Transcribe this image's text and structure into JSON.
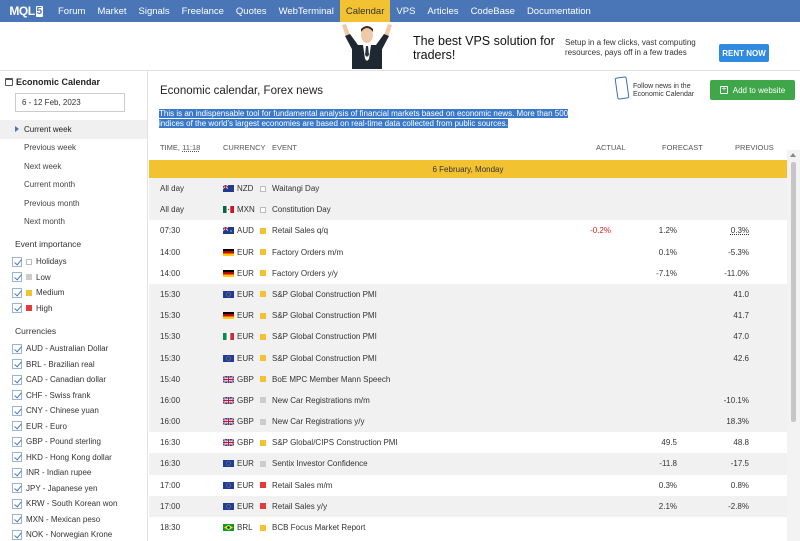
{
  "nav": {
    "logo": "MQL",
    "logo_suffix": "5",
    "items": [
      {
        "label": "Forum",
        "active": false
      },
      {
        "label": "Market",
        "active": false
      },
      {
        "label": "Signals",
        "active": false
      },
      {
        "label": "Freelance",
        "active": false
      },
      {
        "label": "Quotes",
        "active": false
      },
      {
        "label": "WebTerminal",
        "active": false
      },
      {
        "label": "Calendar",
        "active": true
      },
      {
        "label": "VPS",
        "active": false
      },
      {
        "label": "Articles",
        "active": false
      },
      {
        "label": "CodeBase",
        "active": false
      },
      {
        "label": "Documentation",
        "active": false
      }
    ]
  },
  "banner": {
    "headline": "The best VPS solution for traders!",
    "sub": "Setup in a few clicks, vast computing resources, pays off in a few trades",
    "button": "RENT NOW"
  },
  "sidebar": {
    "title": "Economic Calendar",
    "date_range": "6 - 12 Feb, 2023",
    "periods": [
      {
        "label": "Current week",
        "active": true
      },
      {
        "label": "Previous week",
        "active": false
      },
      {
        "label": "Next week",
        "active": false
      },
      {
        "label": "Current month",
        "active": false
      },
      {
        "label": "Previous month",
        "active": false
      },
      {
        "label": "Next month",
        "active": false
      }
    ],
    "importance_title": "Event importance",
    "importance": [
      {
        "label": "Holidays",
        "level": "holidays"
      },
      {
        "label": "Low",
        "level": "low"
      },
      {
        "label": "Medium",
        "level": "medium"
      },
      {
        "label": "High",
        "level": "high"
      }
    ],
    "currencies_title": "Currencies",
    "currencies": [
      "AUD - Australian Dollar",
      "BRL - Brazilian real",
      "CAD - Canadian dollar",
      "CHF - Swiss frank",
      "CNY - Chinese yuan",
      "EUR - Euro",
      "GBP - Pound sterling",
      "HKD - Hong Kong dollar",
      "INR - Indian rupee",
      "JPY - Japanese yen",
      "KRW - South Korean won",
      "MXN - Mexican peso",
      "NOK - Norwegian Krone"
    ]
  },
  "main": {
    "title": "Economic calendar, Forex news",
    "follow": "Follow news in the Economic Calendar",
    "add_button": "Add to website",
    "description": "This is an indispensable tool for fundamental analysis of financial markets based on economic news. More than 500 indices of the world's largest economies are based on real-time data collected from public sources.",
    "columns": {
      "time": "TIME,",
      "time_value": "11:18",
      "currency": "CURRENCY",
      "event": "EVENT",
      "actual": "ACTUAL",
      "forecast": "FORECAST",
      "previous": "PREVIOUS"
    },
    "day_header": "6 February, Monday",
    "rows": [
      {
        "time": "All day",
        "currency": "NZD",
        "flag": "nz",
        "imp": "holidays",
        "event": "Waitangi Day",
        "actual": "",
        "forecast": "",
        "previous": "",
        "alt": true
      },
      {
        "time": "All day",
        "currency": "MXN",
        "flag": "mx",
        "imp": "holidays",
        "event": "Constitution Day",
        "actual": "",
        "forecast": "",
        "previous": "",
        "alt": true
      },
      {
        "time": "07:30",
        "currency": "AUD",
        "flag": "au",
        "imp": "medium",
        "event": "Retail Sales q/q",
        "actual": "-0.2%",
        "forecast": "1.2%",
        "previous": "0.3%",
        "alt": false,
        "prev_underline": true
      },
      {
        "time": "14:00",
        "currency": "EUR",
        "flag": "de",
        "imp": "medium",
        "event": "Factory Orders m/m",
        "actual": "",
        "forecast": "0.1%",
        "previous": "-5.3%",
        "alt": false
      },
      {
        "time": "14:00",
        "currency": "EUR",
        "flag": "de",
        "imp": "medium",
        "event": "Factory Orders y/y",
        "actual": "",
        "forecast": "-7.1%",
        "previous": "-11.0%",
        "alt": false
      },
      {
        "time": "15:30",
        "currency": "EUR",
        "flag": "eu",
        "imp": "medium",
        "event": "S&P Global Construction PMI",
        "actual": "",
        "forecast": "",
        "previous": "41.0",
        "alt": true
      },
      {
        "time": "15:30",
        "currency": "EUR",
        "flag": "de",
        "imp": "medium",
        "event": "S&P Global Construction PMI",
        "actual": "",
        "forecast": "",
        "previous": "41.7",
        "alt": true
      },
      {
        "time": "15:30",
        "currency": "EUR",
        "flag": "it",
        "imp": "medium",
        "event": "S&P Global Construction PMI",
        "actual": "",
        "forecast": "",
        "previous": "47.0",
        "alt": true
      },
      {
        "time": "15:30",
        "currency": "EUR",
        "flag": "eu",
        "imp": "medium",
        "event": "S&P Global Construction PMI",
        "actual": "",
        "forecast": "",
        "previous": "42.6",
        "alt": true
      },
      {
        "time": "15:40",
        "currency": "GBP",
        "flag": "gb",
        "imp": "medium",
        "event": "BoE MPC Member Mann Speech",
        "actual": "",
        "forecast": "",
        "previous": "",
        "alt": true
      },
      {
        "time": "16:00",
        "currency": "GBP",
        "flag": "gb",
        "imp": "low",
        "event": "New Car Registrations m/m",
        "actual": "",
        "forecast": "",
        "previous": "-10.1%",
        "alt": true
      },
      {
        "time": "16:00",
        "currency": "GBP",
        "flag": "gb",
        "imp": "low",
        "event": "New Car Registrations y/y",
        "actual": "",
        "forecast": "",
        "previous": "18.3%",
        "alt": true
      },
      {
        "time": "16:30",
        "currency": "GBP",
        "flag": "gb",
        "imp": "medium",
        "event": "S&P Global/CIPS Construction PMI",
        "actual": "",
        "forecast": "49.5",
        "previous": "48.8",
        "alt": false
      },
      {
        "time": "16:30",
        "currency": "EUR",
        "flag": "eu",
        "imp": "low",
        "event": "Sentix Investor Confidence",
        "actual": "",
        "forecast": "-11.8",
        "previous": "-17.5",
        "alt": true
      },
      {
        "time": "17:00",
        "currency": "EUR",
        "flag": "eu",
        "imp": "high",
        "event": "Retail Sales m/m",
        "actual": "",
        "forecast": "0.3%",
        "previous": "0.8%",
        "alt": false
      },
      {
        "time": "17:00",
        "currency": "EUR",
        "flag": "eu",
        "imp": "high",
        "event": "Retail Sales y/y",
        "actual": "",
        "forecast": "2.1%",
        "previous": "-2.8%",
        "alt": true
      },
      {
        "time": "18:30",
        "currency": "BRL",
        "flag": "br",
        "imp": "medium",
        "event": "BCB Focus Market Report",
        "actual": "",
        "forecast": "",
        "previous": "",
        "alt": false
      }
    ]
  }
}
